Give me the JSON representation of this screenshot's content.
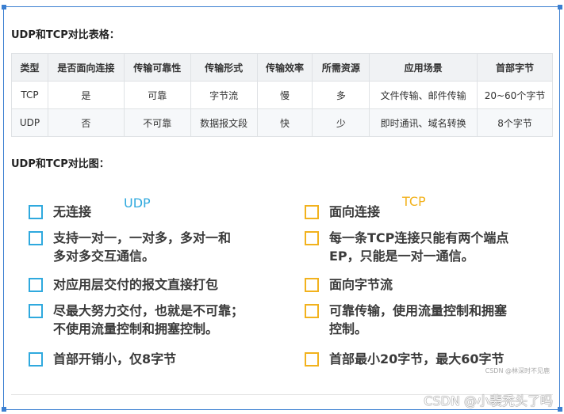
{
  "section1": {
    "title": "UDP和TCP对比表格："
  },
  "table": {
    "headers": [
      "类型",
      "是否面向连接",
      "传输可靠性",
      "传输形式",
      "传输效率",
      "所需资源",
      "应用场景",
      "首部字节"
    ],
    "rows": [
      [
        "TCP",
        "是",
        "可靠",
        "字节流",
        "慢",
        "多",
        "文件传输、邮件传输",
        "20~60个字节"
      ],
      [
        "UDP",
        "否",
        "不可靠",
        "数据报文段",
        "快",
        "少",
        "即时通讯、域名转换",
        "8个字节"
      ]
    ]
  },
  "section2": {
    "title": "UDP和TCP对比图："
  },
  "diagram": {
    "udp_label": "UDP",
    "tcp_label": "TCP",
    "udp_items": [
      [
        "无连接"
      ],
      [
        "支持一对一，一对多，多对一和",
        "多对多交互通信。"
      ],
      [
        "对应用层交付的报文直接打包"
      ],
      [
        "尽最大努力交付，也就是不可靠；",
        "不使用流量控制和拥塞控制。"
      ],
      [
        "首部开销小，仅8字节"
      ]
    ],
    "tcp_items": [
      [
        "面向连接"
      ],
      [
        "每一条TCP连接只能有两个端点",
        "EP，只能是一对一通信。"
      ],
      [
        "面向字节流"
      ],
      [
        "可靠传输，使用流量控制和拥塞",
        "控制。"
      ],
      [
        "首部最小20字节，最大60字节"
      ]
    ],
    "colors": {
      "udp": "#2fa9de",
      "tcp": "#f2b21d"
    },
    "inner_watermark": "CSDN @林深时不见鹿"
  },
  "watermark": "CSDN @小裴秃头了吗"
}
